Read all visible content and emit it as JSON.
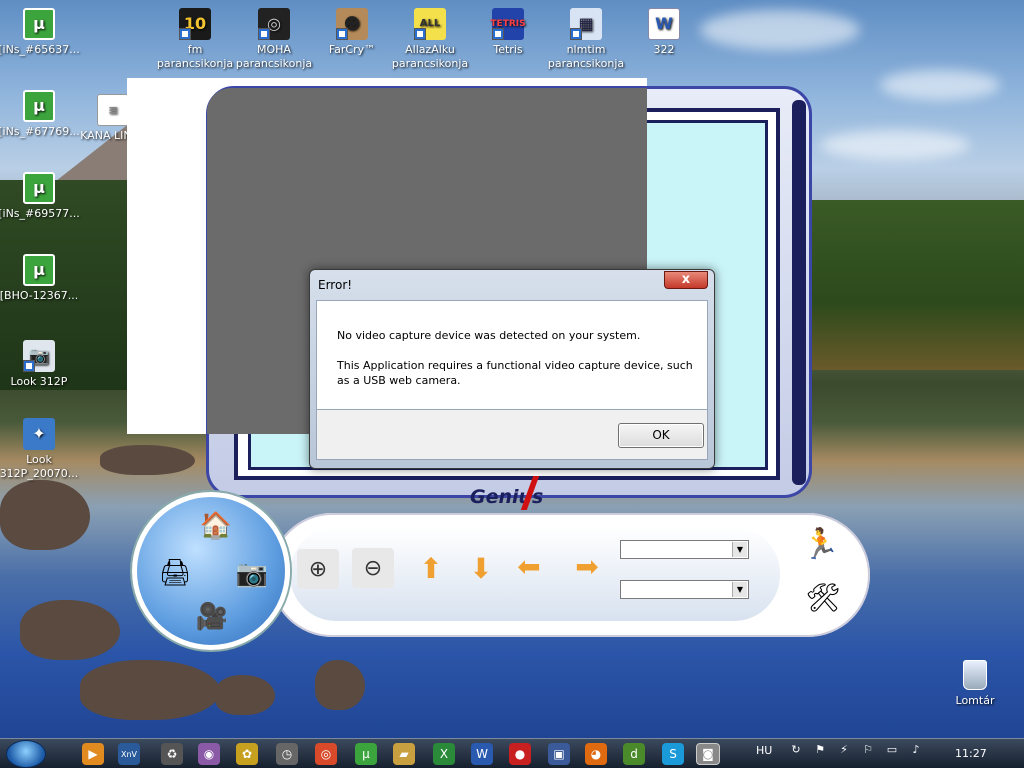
{
  "desktop": {
    "icons": [
      {
        "label": "[iNs_#65637...",
        "icon": "utorrent-icon"
      },
      {
        "label": "[iNs_#67769...",
        "icon": "utorrent-icon"
      },
      {
        "label": "[iNs_#69577...",
        "icon": "utorrent-icon"
      },
      {
        "label": "[BHO-12367...",
        "icon": "utorrent-icon"
      },
      {
        "label": "Look 312P",
        "icon": "camera-shortcut-icon"
      },
      {
        "label": "Look 312P_20070...",
        "icon": "installer-icon"
      },
      {
        "label": "KANA LINKE",
        "icon": "document-icon"
      },
      {
        "label": "fm parancsikonja",
        "icon": "fm-game-icon"
      },
      {
        "label": "MOHA parancsikonja",
        "icon": "moha-game-icon"
      },
      {
        "label": "FarCry™",
        "icon": "farcry-icon"
      },
      {
        "label": "AllazAlku parancsikonja",
        "icon": "allazalku-icon"
      },
      {
        "label": "Tetris",
        "icon": "tetris-icon"
      },
      {
        "label": "nlmtim parancsikonja",
        "icon": "app-window-icon"
      },
      {
        "label": "322",
        "icon": "word-document-icon"
      }
    ],
    "recycle_bin": "Lomtár"
  },
  "app": {
    "brand": "Genius",
    "mode_icons": [
      "home-icon",
      "scanner-icon",
      "camera-icon",
      "video-camera-icon"
    ],
    "controls": [
      "zoom-in-icon",
      "zoom-out-icon",
      "arrow-up-icon",
      "arrow-down-icon",
      "arrow-left-icon",
      "arrow-right-icon"
    ],
    "dropdown_1_value": "",
    "dropdown_2_value": "",
    "side_icons": [
      "running-man-icon",
      "tools-icon"
    ]
  },
  "dialog": {
    "title": "Error!",
    "close": "x",
    "message_1": "No video capture device was detected on your system.",
    "message_2": "This Application requires a functional video capture device, such as a USB web camera.",
    "ok": "OK"
  },
  "taskbar": {
    "language": "HU",
    "time": "11:27",
    "items": [
      "media-player-icon",
      "xnview-icon",
      "recycle-tool-icon",
      "network-icon",
      "paint-icon",
      "clock-icon",
      "chrome-icon",
      "utorrent-icon",
      "folder-icon",
      "excel-icon",
      "word-icon",
      "antivirus-icon",
      "floppy-icon",
      "firefox-icon",
      "vuze-icon",
      "skype-icon",
      "camera-icon"
    ]
  },
  "colors": {
    "accent": "#1b1f5c",
    "screen": "#c9f4f8",
    "arrow": "#f0a030",
    "brand_red": "#d01010"
  }
}
